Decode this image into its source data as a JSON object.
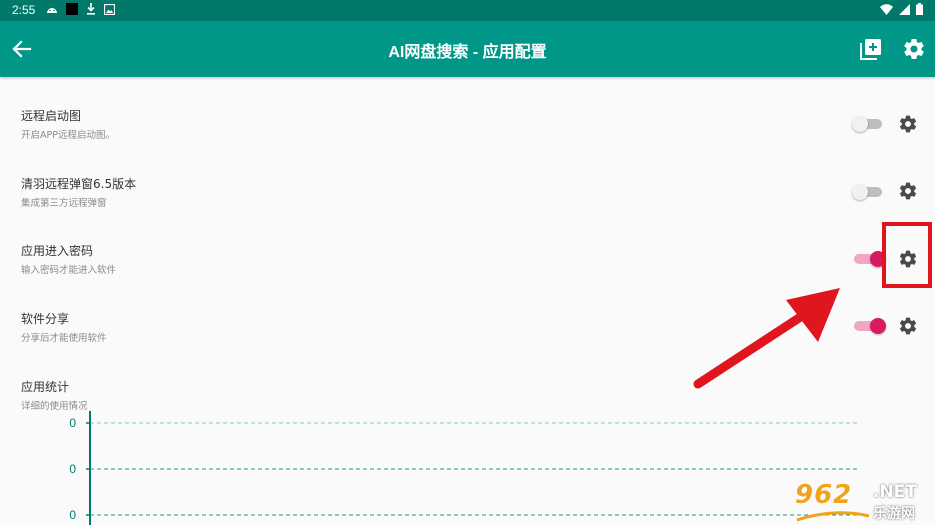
{
  "status_bar": {
    "time": "2:55",
    "left_icons": [
      "android-icon",
      "black-square-icon",
      "download-icon",
      "photo-icon"
    ],
    "right_icons": [
      "wifi-icon",
      "signal-icon",
      "battery-icon"
    ]
  },
  "app_bar": {
    "title": "AI网盘搜索 - 应用配置",
    "icons": [
      "back-arrow-icon",
      "add-page-icon",
      "gear-icon"
    ],
    "color": "#009688"
  },
  "settings": [
    {
      "title": "远程启动图",
      "subtitle": "开启APP远程启动图。",
      "enabled": false
    },
    {
      "title": "清羽远程弹窗6.5版本",
      "subtitle": "集成第三方远程弹窗",
      "enabled": false
    },
    {
      "title": "应用进入密码",
      "subtitle": "输入密码才能进入软件",
      "enabled": true
    },
    {
      "title": "软件分享",
      "subtitle": "分享后才能使用软件",
      "enabled": true
    }
  ],
  "stats": {
    "title": "应用统计",
    "subtitle": "详细的使用情况"
  },
  "chart_data": {
    "type": "line",
    "title": "",
    "xlabel": "",
    "ylabel": "",
    "y_ticks": [
      "0",
      "0",
      "0"
    ],
    "series": [],
    "grid": true
  },
  "annotation": {
    "highlight_color": "#e0161e",
    "arrow_color": "#e0161e"
  },
  "watermark": {
    "number": "962",
    "domain": ".NET",
    "chinese": "乐游网"
  },
  "colors": {
    "accent_pink": "#d81b60",
    "teal": "#009688",
    "teal_dark": "#00796b"
  }
}
